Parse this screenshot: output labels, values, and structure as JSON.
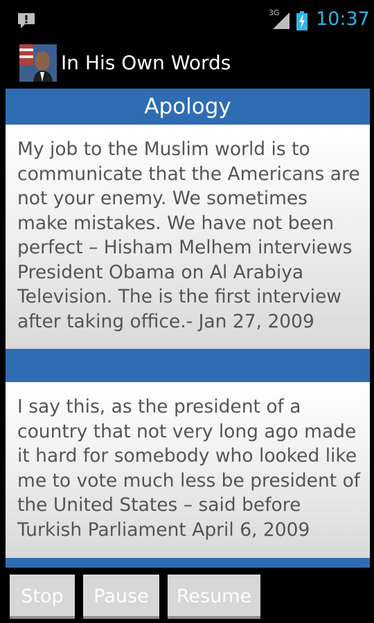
{
  "status_bar": {
    "notification_icon": "exclamation-bubble-icon",
    "network_type": "3G",
    "signal_icon": "cell-signal-icon",
    "battery_icon": "battery-charging-icon",
    "time": "10:37",
    "time_color": "#33b5e5"
  },
  "action_bar": {
    "app_icon": "portrait-icon",
    "title": "In His Own Words"
  },
  "content": {
    "section_title": "Apology",
    "accent_color": "#2e6db2",
    "quotes": [
      {
        "text": "My job to the Muslim world is to communicate that the Americans are not your enemy. We sometimes make mistakes. We have not been perfect – Hisham Melhem interviews President Obama on Al Arabiya Television. The is the first interview after taking office.- Jan 27, 2009"
      },
      {
        "text": "I say this, as the president of a country that not very long ago made it hard for somebody who looked like me to vote much less be president of the United States – said before Turkish Parliament April 6, 2009"
      }
    ]
  },
  "controls": {
    "stop_label": "Stop",
    "pause_label": "Pause",
    "resume_label": "Resume"
  }
}
